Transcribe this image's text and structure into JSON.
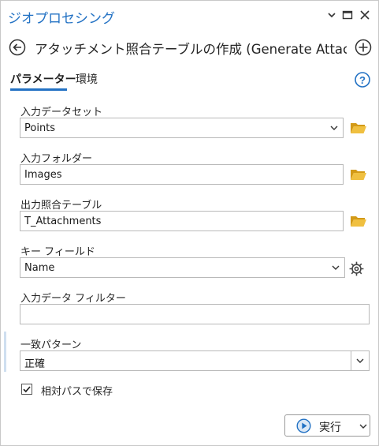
{
  "pane": {
    "title": "ジオプロセシング"
  },
  "tool": {
    "title": "アタッチメント照合テーブルの作成 (Generate Attac..."
  },
  "tabs": [
    {
      "label": "パラメーター",
      "active": true
    },
    {
      "label": "環境",
      "active": false
    }
  ],
  "params": {
    "input_dataset": {
      "label": "入力データセット",
      "value": "Points"
    },
    "input_folder": {
      "label": "入力フォルダー",
      "value": "Images"
    },
    "output_table": {
      "label": "出力照合テーブル",
      "value": "T_Attachments"
    },
    "key_field": {
      "label": "キー フィールド",
      "value": "Name"
    },
    "input_filter": {
      "label": "入力データ フィルター",
      "value": ""
    },
    "match_pattern": {
      "label": "一致パターン",
      "value": "正確"
    },
    "relative_path": {
      "label": "相対パスで保存",
      "checked": true
    }
  },
  "run": {
    "label": "実行"
  },
  "colors": {
    "accent": "#2372c4",
    "folder": "#e8b22a"
  }
}
